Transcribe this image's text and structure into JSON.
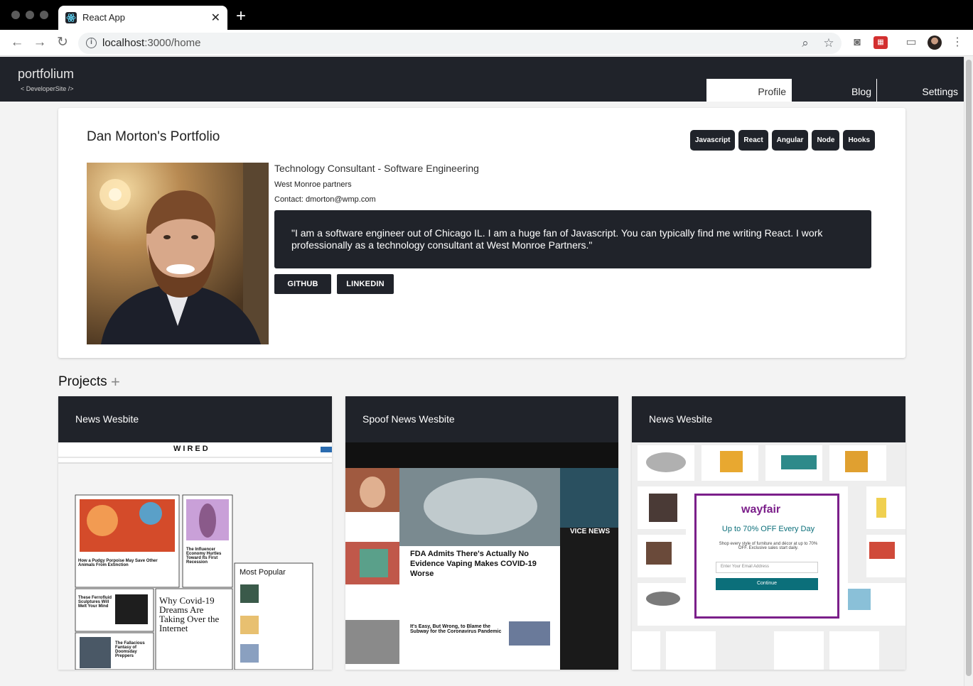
{
  "browser": {
    "tab_title": "React App",
    "url_host": "localhost",
    "url_path": ":3000/home"
  },
  "app": {
    "brand": "portfolium",
    "brand_sub": "< DeveloperSite />",
    "nav": [
      "Profile",
      "Blog",
      "Settings"
    ]
  },
  "profile": {
    "title": "Dan Morton's Portfolio",
    "skills": [
      "Javascript",
      "React",
      "Angular",
      "Node",
      "Hooks"
    ],
    "job_title": "Technology Consultant - Software Engineering",
    "company": "West Monroe partners",
    "contact": "Contact: dmorton@wmp.com",
    "bio": "\"I am a software engineer out of Chicago IL. I am a huge fan of Javascript. You can typically find me writing React. I work professionally as a technology consultant at West Monroe Partners.\"",
    "github_label": "GITHUB",
    "linkedin_label": "LINKEDIN"
  },
  "projects": {
    "heading": "Projects",
    "add": "+",
    "items": [
      {
        "title": "News Wesbite",
        "shot": {
          "logo": "WIRED",
          "popular": "Most Popular",
          "story1": "How a Pudgy Porpoise May Save Other Animals From Extinction",
          "story2": "The Influencer Economy Hurtles Toward Its First Recession",
          "story3": "These Ferrofluid Sculptures Will Melt Your Mind",
          "story4": "Why Covid-19 Dreams Are Taking Over the Internet",
          "story5": "The Fallacious Fantasy of Doomsday Preppers"
        }
      },
      {
        "title": "Spoof News Wesbite",
        "shot": {
          "headline": "FDA Admits There's Actually No Evidence Vaping Makes COVID-19 Worse",
          "headline2": "It's Easy, But Wrong, to Blame the Subway for the Coronavirus Pandemic",
          "section": "VICE NEWS"
        }
      },
      {
        "title": "News Wesbite",
        "shot": {
          "logo": "wayfair",
          "offer": "Up to 70% OFF Every Day",
          "blurb": "Shop every style of furniture and décor at up to 70% OFF. Exclusive sales start daily.",
          "email_placeholder": "Enter Your Email Address",
          "cta": "Continue"
        }
      }
    ]
  },
  "colors": {
    "dark": "#20232a",
    "page_bg": "#f3f3f3",
    "wayfair_purple": "#7b1f8a",
    "wayfair_teal": "#0b6f7a"
  }
}
